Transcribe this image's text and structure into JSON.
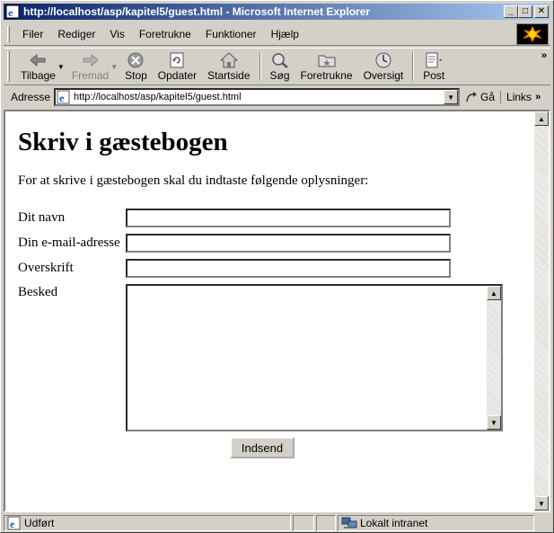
{
  "window": {
    "title": "http://localhost/asp/kapitel5/guest.html - Microsoft Internet Explorer",
    "minimize": "_",
    "maximize": "□",
    "close": "✕"
  },
  "menu": {
    "items": [
      {
        "label": "Filer"
      },
      {
        "label": "Rediger"
      },
      {
        "label": "Vis"
      },
      {
        "label": "Foretrukne"
      },
      {
        "label": "Funktioner"
      },
      {
        "label": "Hjælp"
      }
    ]
  },
  "toolbar": {
    "back": "Tilbage",
    "forward": "Fremad",
    "stop": "Stop",
    "refresh": "Opdater",
    "home": "Startside",
    "search": "Søg",
    "favorites": "Foretrukne",
    "history": "Oversigt",
    "mail": "Post",
    "more": "»"
  },
  "address": {
    "label": "Adresse",
    "url": "http://localhost/asp/kapitel5/guest.html",
    "go": "Gå",
    "links": "Links",
    "more": "»"
  },
  "page": {
    "heading": "Skriv i gæstebogen",
    "intro": "For at skrive i gæstebogen skal du indtaste følgende oplysninger:",
    "fields": {
      "name_label": "Dit navn",
      "email_label": "Din e-mail-adresse",
      "subject_label": "Overskrift",
      "message_label": "Besked"
    },
    "submit": "Indsend"
  },
  "status": {
    "text": "Udført",
    "zone": "Lokalt intranet"
  },
  "colors": {
    "title_start": "#0a246a",
    "title_end": "#a6caf0",
    "chrome": "#d4d0c8"
  }
}
